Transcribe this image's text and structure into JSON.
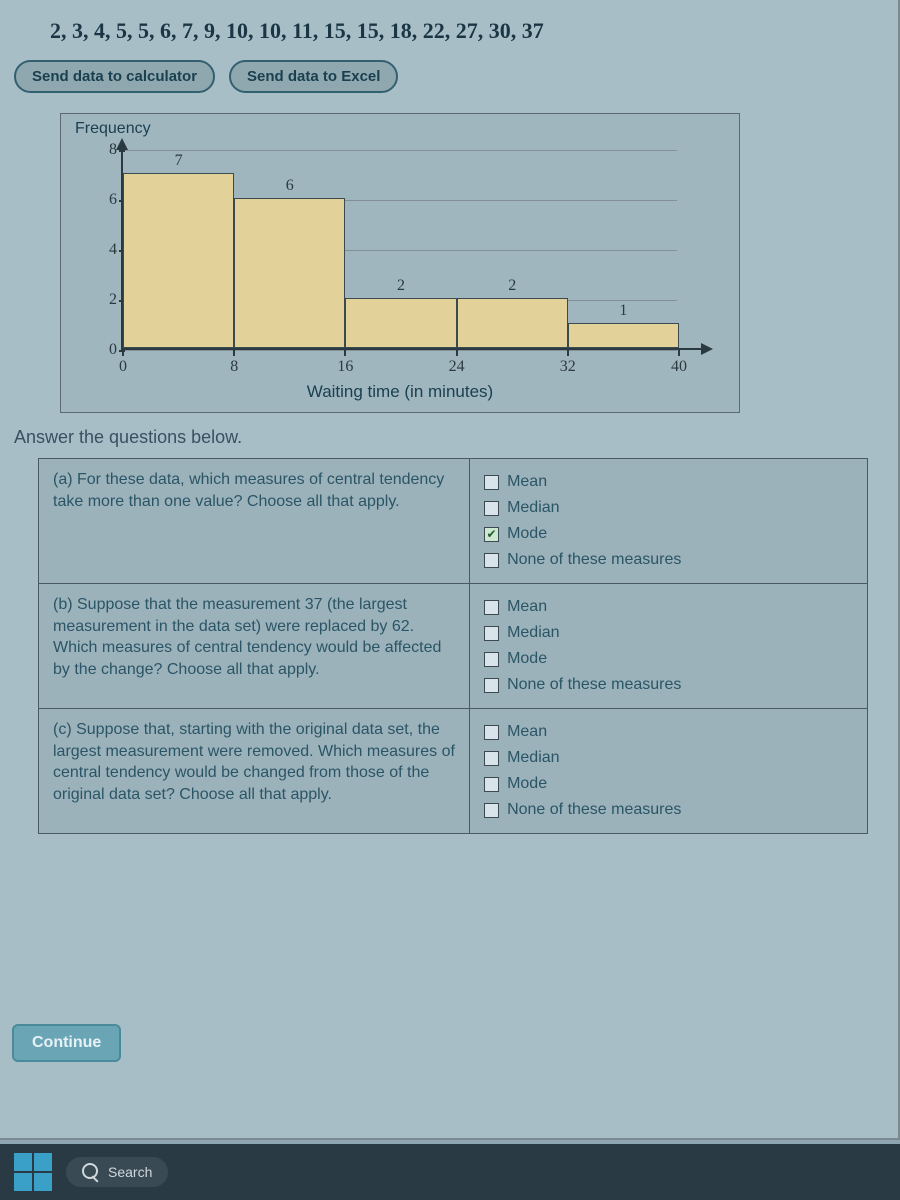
{
  "data_list": "2, 3, 4, 5, 5, 6, 7, 9, 10, 10, 11, 15, 15, 18, 22, 27, 30, 37",
  "buttons": {
    "calc": "Send data to calculator",
    "excel": "Send data to Excel"
  },
  "chart_data": {
    "type": "bar",
    "y_title": "Frequency",
    "x_title": "Waiting time (in minutes)",
    "y_ticks": [
      0,
      2,
      4,
      6,
      8
    ],
    "x_ticks": [
      0,
      8,
      16,
      24,
      32,
      40
    ],
    "bins": [
      {
        "from": 0,
        "to": 8,
        "value": 7
      },
      {
        "from": 8,
        "to": 16,
        "value": 6
      },
      {
        "from": 16,
        "to": 24,
        "value": 2
      },
      {
        "from": 24,
        "to": 32,
        "value": 2
      },
      {
        "from": 32,
        "to": 40,
        "value": 1
      }
    ],
    "ylim": [
      0,
      8
    ],
    "xlim": [
      0,
      40
    ]
  },
  "answer_header": "Answer the questions below.",
  "option_labels": {
    "mean": "Mean",
    "median": "Median",
    "mode": "Mode",
    "none": "None of these measures"
  },
  "questions": [
    {
      "prompt": "(a) For these data, which measures of central tendency take more than one value? Choose all that apply.",
      "checked": {
        "mean": false,
        "median": false,
        "mode": true,
        "none": false
      }
    },
    {
      "prompt": "(b) Suppose that the measurement 37 (the largest measurement in the data set) were replaced by 62. Which measures of central tendency would be affected by the change? Choose all that apply.",
      "checked": {
        "mean": false,
        "median": false,
        "mode": false,
        "none": false
      }
    },
    {
      "prompt": "(c) Suppose that, starting with the original data set, the largest measurement were removed. Which measures of central tendency would be changed from those of the original data set? Choose all that apply.",
      "checked": {
        "mean": false,
        "median": false,
        "mode": false,
        "none": false
      }
    }
  ],
  "continue": "Continue",
  "search_placeholder": "Search"
}
